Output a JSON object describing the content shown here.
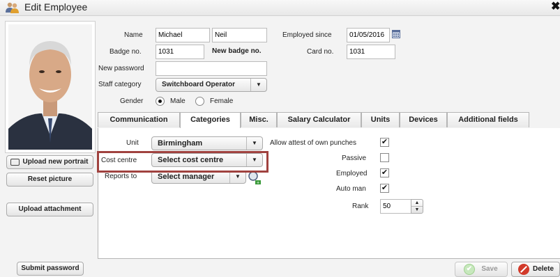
{
  "window": {
    "title": "Edit Employee",
    "close_glyph": "✖"
  },
  "left": {
    "upload_portrait_label": "Upload new portrait",
    "reset_picture_label": "Reset picture",
    "upload_attachment_label": "Upload attachment",
    "submit_password_label": "Submit password"
  },
  "form": {
    "name_label": "Name",
    "first_name": "Michael",
    "last_name": "Neil",
    "employed_since_label": "Employed since",
    "employed_since": "01/05/2016",
    "badge_label": "Badge no.",
    "badge_value": "1031",
    "new_badge_label": "New badge no.",
    "card_label": "Card no.",
    "card_value": "1031",
    "new_password_label": "New password",
    "new_password_value": "",
    "staff_category_label": "Staff category",
    "staff_category_value": "Switchboard Operator",
    "gender_label": "Gender",
    "gender_male": "Male",
    "gender_female": "Female",
    "gender_selected": "Male"
  },
  "tabs": [
    {
      "label": "Communication"
    },
    {
      "label": "Categories"
    },
    {
      "label": "Misc."
    },
    {
      "label": "Salary Calculator"
    },
    {
      "label": "Units"
    },
    {
      "label": "Devices"
    },
    {
      "label": "Additional fields"
    }
  ],
  "active_tab": "Categories",
  "categories": {
    "unit_label": "Unit",
    "unit_value": "Birmingham",
    "cost_centre_label": "Cost centre",
    "cost_centre_value": "Select cost centre",
    "reports_to_label": "Reports to",
    "reports_to_value": "Select manager",
    "allow_attest_label": "Allow attest of own punches",
    "allow_attest_checked": true,
    "passive_label": "Passive",
    "passive_checked": false,
    "employed_label": "Employed",
    "employed_checked": true,
    "auto_man_label": "Auto man",
    "auto_man_checked": true,
    "rank_label": "Rank",
    "rank_value": "50"
  },
  "footer": {
    "save_label": "Save",
    "delete_label": "Delete"
  },
  "colors": {
    "highlight_border": "#a0423f",
    "delete_icon": "#d23a2a",
    "save_icon": "#8fcf7a"
  }
}
